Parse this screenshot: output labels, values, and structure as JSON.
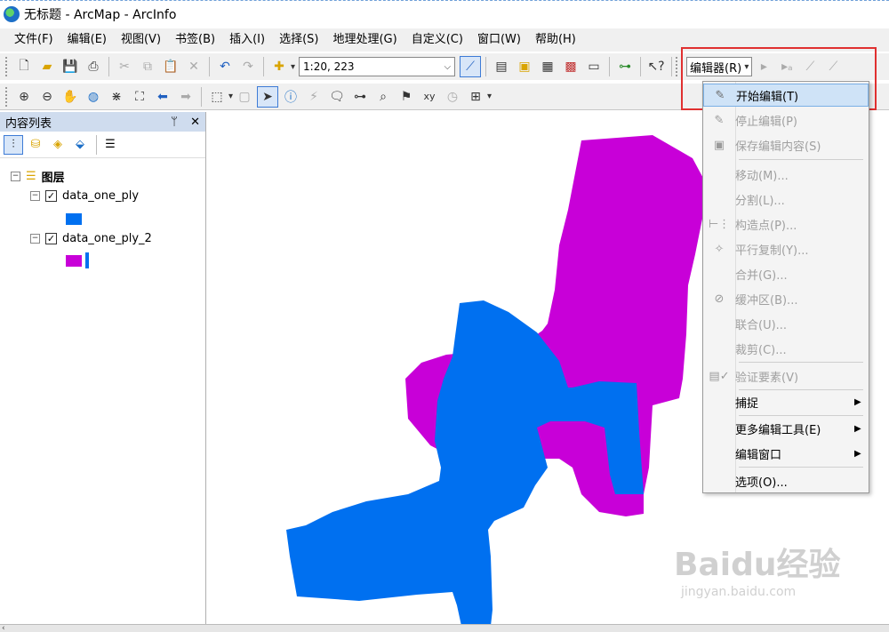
{
  "window": {
    "title": "无标题 - ArcMap - ArcInfo"
  },
  "menubar": [
    "文件(F)",
    "编辑(E)",
    "视图(V)",
    "书签(B)",
    "插入(I)",
    "选择(S)",
    "地理处理(G)",
    "自定义(C)",
    "窗口(W)",
    "帮助(H)"
  ],
  "toolbar": {
    "scale_value": "1:20, 223",
    "editor_label": "编辑器(R)"
  },
  "toc": {
    "title": "内容列表",
    "pin_glyph": "ᛘ",
    "close_glyph": "✕",
    "root_label": "图层",
    "layers": [
      {
        "name": "data_one_ply",
        "color": "#0070f0"
      },
      {
        "name": "data_one_ply_2",
        "color": "#c800d8",
        "outline": "#0070f0"
      }
    ]
  },
  "editor_menu": {
    "items": [
      {
        "label": "开始编辑(T)",
        "state": "highlight",
        "icon": "pencil-icon"
      },
      {
        "label": "停止编辑(P)",
        "state": "disabled",
        "icon": "pencil-stop-icon"
      },
      {
        "label": "保存编辑内容(S)",
        "state": "disabled",
        "icon": "save-icon"
      },
      {
        "label": "移动(M)...",
        "state": "disabled"
      },
      {
        "label": "分割(L)...",
        "state": "disabled"
      },
      {
        "label": "构造点(P)...",
        "state": "disabled",
        "icon": "construct-points-icon"
      },
      {
        "label": "平行复制(Y)...",
        "state": "disabled",
        "icon": "parallel-copy-icon"
      },
      {
        "label": "合并(G)...",
        "state": "disabled"
      },
      {
        "label": "缓冲区(B)...",
        "state": "disabled",
        "icon": "buffer-icon"
      },
      {
        "label": "联合(U)...",
        "state": "disabled"
      },
      {
        "label": "裁剪(C)...",
        "state": "disabled"
      },
      {
        "label": "验证要素(V)",
        "state": "disabled",
        "icon": "validate-icon"
      },
      {
        "label": "捕捉",
        "state": "normal",
        "submenu": true
      },
      {
        "label": "更多编辑工具(E)",
        "state": "normal",
        "submenu": true
      },
      {
        "label": "编辑窗口",
        "state": "normal",
        "submenu": true
      },
      {
        "label": "选项(O)...",
        "state": "normal"
      }
    ]
  },
  "map": {
    "polygon_colors": {
      "blue": "#0070f0",
      "magenta": "#c800d8"
    }
  },
  "watermark": {
    "brand": "Baidu经验",
    "url": "jingyan.baidu.com"
  }
}
